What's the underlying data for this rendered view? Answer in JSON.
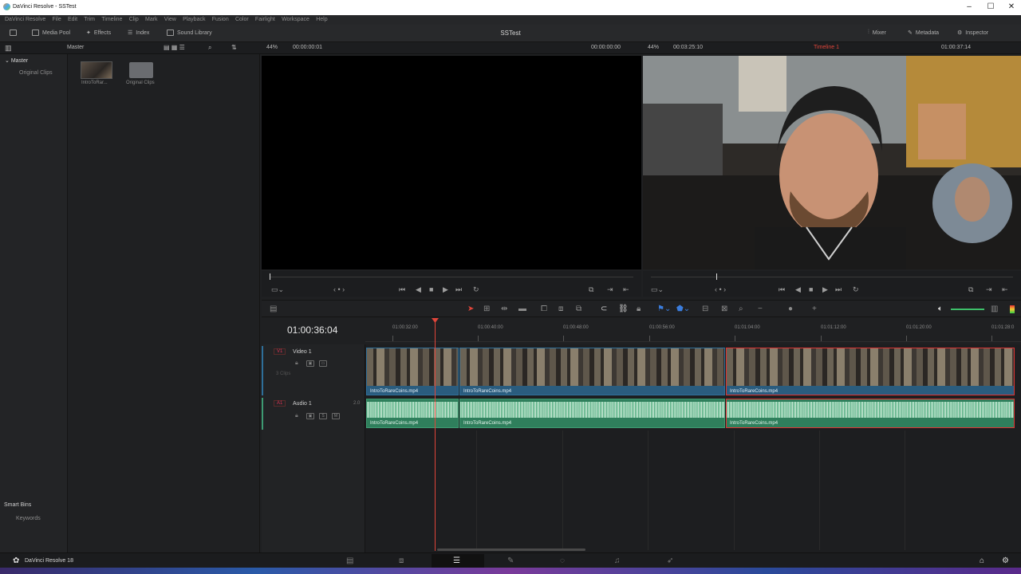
{
  "window": {
    "title": "DaVinci Resolve - SSTest"
  },
  "menu": [
    "DaVinci Resolve",
    "File",
    "Edit",
    "Trim",
    "Timeline",
    "Clip",
    "Mark",
    "View",
    "Playback",
    "Fusion",
    "Color",
    "Fairlight",
    "Workspace",
    "Help"
  ],
  "toolbar": {
    "media_pool": "Media Pool",
    "effects": "Effects",
    "index": "Index",
    "sound_library": "Sound Library",
    "project": "SSTest",
    "mixer": "Mixer",
    "metadata": "Metadata",
    "inspector": "Inspector"
  },
  "subbar": {
    "master": "Master",
    "zoom_left": "44%",
    "tc_left": "00:00:00:01",
    "tc_src": "00:00:00:00",
    "zoom_right": "44%",
    "dur_right": "00:03:25:10",
    "timeline_name": "Timeline 1",
    "tc_right": "01:00:37:14"
  },
  "bins": {
    "master": "Master",
    "original_clips": "Original Clips",
    "smart_bins": "Smart Bins",
    "keywords": "Keywords"
  },
  "media": [
    {
      "label": "IntroToRar..."
    },
    {
      "label": "Original Clips"
    }
  ],
  "timeline": {
    "timecode": "01:00:36:04",
    "ruler": [
      "01:00:32:00",
      "01:00:40:00",
      "01:00:48:00",
      "01:00:56:00",
      "01:01:04:00",
      "01:01:12:00",
      "01:01:20:00",
      "01:01:28:0"
    ],
    "video_track": {
      "tag": "V1",
      "name": "Video 1",
      "clips_count": "3 Clips"
    },
    "audio_track": {
      "tag": "A1",
      "name": "Audio 1",
      "channels": "2.0"
    },
    "clip_name": "IntroToRareCoins.mp4"
  },
  "footer": {
    "app": "DaVinci Resolve 18"
  },
  "colors": {
    "accent": "#e0453a",
    "video_clip": "#2a5c7e",
    "audio_clip": "#2f7f5c"
  }
}
